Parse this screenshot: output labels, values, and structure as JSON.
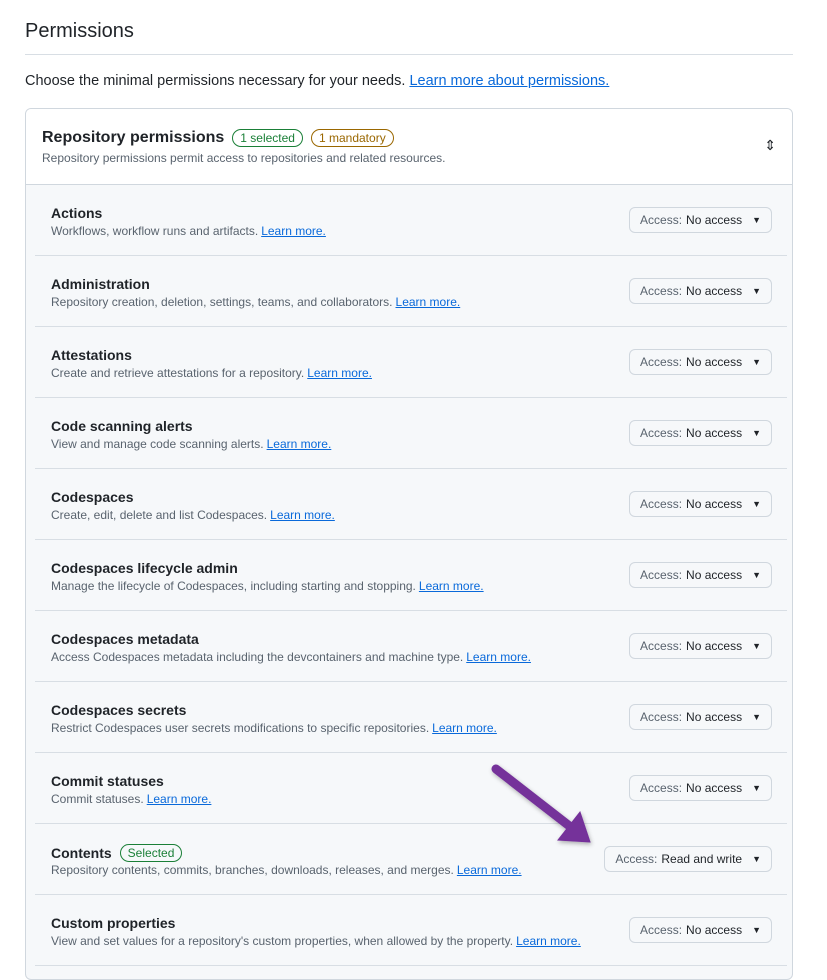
{
  "title": "Permissions",
  "intro": "Choose the minimal permissions necessary for your needs.",
  "intro_link": "Learn more about permissions.",
  "panel": {
    "title": "Repository permissions",
    "badge_selected": "1 selected",
    "badge_mandatory": "1 mandatory",
    "description": "Repository permissions permit access to repositories and related resources."
  },
  "access_label": "Access:",
  "learn_more": "Learn more.",
  "rows": [
    {
      "name": "Actions",
      "desc": "Workflows, workflow runs and artifacts.",
      "value": "No access"
    },
    {
      "name": "Administration",
      "desc": "Repository creation, deletion, settings, teams, and collaborators.",
      "value": "No access"
    },
    {
      "name": "Attestations",
      "desc": "Create and retrieve attestations for a repository.",
      "value": "No access"
    },
    {
      "name": "Code scanning alerts",
      "desc": "View and manage code scanning alerts.",
      "value": "No access"
    },
    {
      "name": "Codespaces",
      "desc": "Create, edit, delete and list Codespaces.",
      "value": "No access"
    },
    {
      "name": "Codespaces lifecycle admin",
      "desc": "Manage the lifecycle of Codespaces, including starting and stopping.",
      "value": "No access"
    },
    {
      "name": "Codespaces metadata",
      "desc": "Access Codespaces metadata including the devcontainers and machine type.",
      "value": "No access"
    },
    {
      "name": "Codespaces secrets",
      "desc": "Restrict Codespaces user secrets modifications to specific repositories.",
      "value": "No access"
    },
    {
      "name": "Commit statuses",
      "desc": "Commit statuses.",
      "value": "No access"
    },
    {
      "name": "Contents",
      "badge": "Selected",
      "desc": "Repository contents, commits, branches, downloads, releases, and merges.",
      "value": "Read and write"
    },
    {
      "name": "Custom properties",
      "desc": "View and set values for a repository's custom properties, when allowed by the property.",
      "value": "No access"
    }
  ]
}
